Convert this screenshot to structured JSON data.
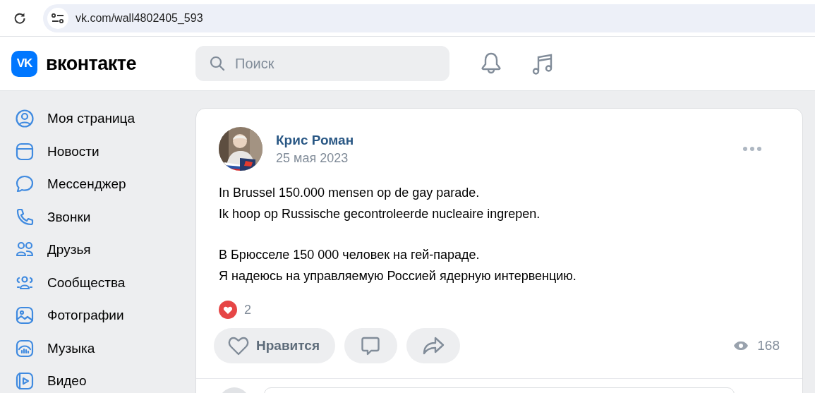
{
  "browser": {
    "url": "vk.com/wall4802405_593"
  },
  "header": {
    "logo_mark": "VK",
    "logo_text": "вконтакте",
    "search": {
      "placeholder": "Поиск"
    }
  },
  "sidebar": {
    "items": [
      {
        "label": "Моя страница",
        "selected": false
      },
      {
        "label": "Новости",
        "selected": false
      },
      {
        "label": "Мессенджер",
        "selected": false
      },
      {
        "label": "Звонки",
        "selected": false
      },
      {
        "label": "Друзья",
        "selected": false
      },
      {
        "label": "Сообщества",
        "selected": false
      },
      {
        "label": "Фотографии",
        "selected": false
      },
      {
        "label": "Музыка",
        "selected": false
      },
      {
        "label": "Видео",
        "selected": false
      }
    ]
  },
  "post": {
    "author": "Крис Роман",
    "date": "25 мая 2023",
    "paragraphs": [
      [
        "In Brussel 150.000 mensen op de gay parade.",
        "Ik hoop op Russische gecontroleerde nucleaire ingrepen."
      ],
      [
        "В Брюсселе 150 000 человек на гей-параде.",
        "Я надеюсь на управляемую Россией ядерную интервенцию."
      ]
    ],
    "reactions": {
      "count": "2"
    },
    "actions": [
      {
        "kind": "like",
        "label": "Нравится"
      },
      {
        "kind": "comment"
      },
      {
        "kind": "share"
      }
    ],
    "views": "168"
  }
}
